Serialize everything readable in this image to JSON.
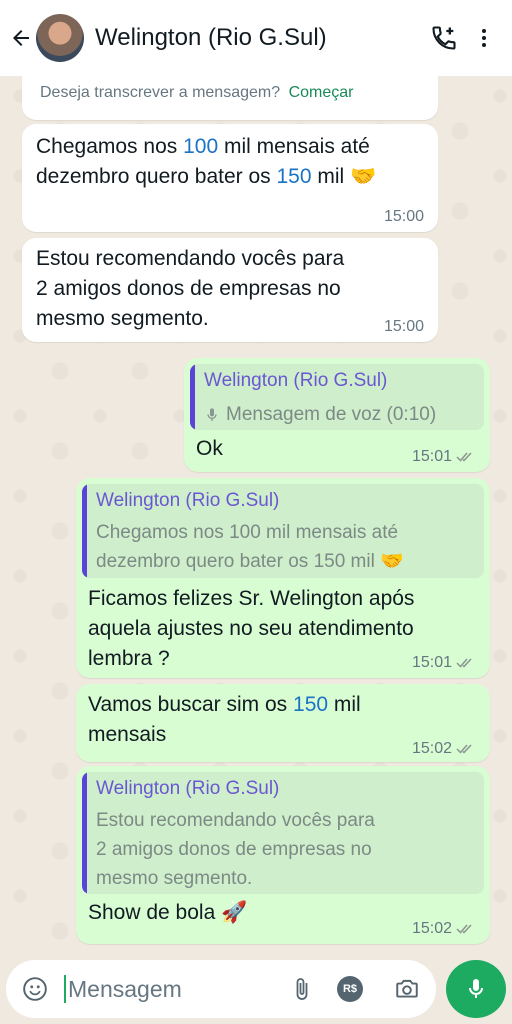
{
  "header": {
    "contact_name": "Welington (Rio G.Sul)",
    "icons": [
      "back-arrow-icon",
      "avatar",
      "add-call-icon",
      "more-vert-icon"
    ]
  },
  "transcribe": {
    "prompt": "Deseja transcrever a mensagem?",
    "action": "Começar"
  },
  "messages": [
    {
      "direction": "in",
      "parts": [
        "Chegamos nos ",
        "100",
        " mil mensais até",
        "dezembro quero bater os ",
        "150",
        " mil 🤝"
      ],
      "time": "15:00"
    },
    {
      "direction": "in",
      "lines": [
        "Estou recomendando vocês para",
        "2 amigos donos de empresas no",
        "mesmo segmento."
      ],
      "time": "15:00"
    },
    {
      "direction": "out",
      "quote_name": "Welington (Rio G.Sul)",
      "quote_text": "Mensagem de voz (0:10)",
      "text": "Ok",
      "time": "15:01"
    },
    {
      "direction": "out",
      "quote_name": "Welington (Rio G.Sul)",
      "quote_lines": [
        "Chegamos nos 100 mil mensais até",
        "dezembro quero bater os 150 mil 🤝"
      ],
      "lines": [
        "Ficamos felizes Sr. Welington após",
        "aquela ajustes no seu atendimento",
        "lembra ?"
      ],
      "time": "15:01"
    },
    {
      "direction": "out",
      "parts": [
        "Vamos buscar sim os ",
        "150",
        " mil",
        "mensais"
      ],
      "time": "15:02"
    },
    {
      "direction": "out",
      "quote_name": "Welington (Rio G.Sul)",
      "quote_lines": [
        "Estou recomendando vocês para",
        "2 amigos donos de empresas no",
        "mesmo segmento."
      ],
      "text": "Show de bola 🚀",
      "time": "15:02"
    }
  ],
  "composer": {
    "placeholder": "Mensagem",
    "icons": [
      "emoji-icon",
      "attach-icon",
      "payment-icon",
      "camera-icon",
      "mic-icon"
    ],
    "payment_label": "R$"
  },
  "colors": {
    "outgoing_bubble": "#d9fdd3",
    "incoming_bubble": "#ffffff",
    "quote_accent": "#5a44d6",
    "number_highlight": "#1a73c7",
    "send_button": "#1daa61"
  }
}
